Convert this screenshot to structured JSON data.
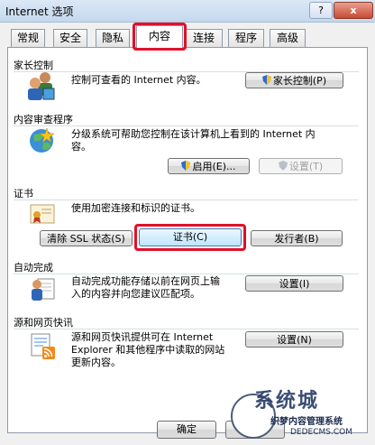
{
  "window": {
    "title": "Internet 选项",
    "help_label": "?",
    "close_label": "x"
  },
  "tabs": [
    {
      "label": "常规"
    },
    {
      "label": "安全"
    },
    {
      "label": "隐私"
    },
    {
      "label": "内容"
    },
    {
      "label": "连接"
    },
    {
      "label": "程序"
    },
    {
      "label": "高级"
    }
  ],
  "active_tab": "内容",
  "sections": {
    "parental": {
      "title": "家长控制",
      "description": "控制可查看的 Internet 内容。",
      "button": "家长控制(P)"
    },
    "advisor": {
      "title": "内容审查程序",
      "description_line1": "分级系统可帮助您控制在该计算机上看到的 Internet 内",
      "description_line2": "容。",
      "enable_button": "启用(E)...",
      "settings_button": "设置(T)"
    },
    "certificates": {
      "title": "证书",
      "description": "使用加密连接和标识的证书。",
      "clear_ssl_button": "清除 SSL 状态(S)",
      "certificates_button": "证书(C)",
      "publishers_button": "发行者(B)"
    },
    "autocomplete": {
      "title": "自动完成",
      "description_line1": "自动完成功能存储以前在网页上输",
      "description_line2": "入的内容并向您建议匹配项。",
      "settings_button": "设置(I)"
    },
    "feeds": {
      "title": "源和网页快讯",
      "description_line1": "源和网页快讯提供可在 Internet",
      "description_line2": "Explorer 和其他程序中读取的网站",
      "description_line3": "更新内容。",
      "settings_button": "设置(N)"
    }
  },
  "footer": {
    "ok_button": "确定",
    "cancel_button": "取消"
  },
  "watermark": {
    "brand": "系统城",
    "subtitle": "织梦内容管理系统",
    "url": "DEDECMS.COM"
  },
  "colors": {
    "highlight": "#e0102a",
    "titlebar": "#c4d8ee"
  }
}
